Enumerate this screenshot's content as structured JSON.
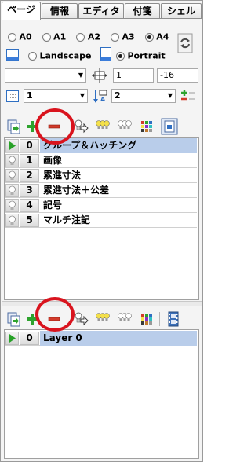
{
  "tabs": [
    {
      "label": "ページ",
      "active": true
    },
    {
      "label": "情報",
      "active": false
    },
    {
      "label": "エディタ",
      "active": false
    },
    {
      "label": "付箋",
      "active": false
    },
    {
      "label": "シェル",
      "active": false
    }
  ],
  "paper_sizes": [
    {
      "label": "A0",
      "selected": false
    },
    {
      "label": "A1",
      "selected": false
    },
    {
      "label": "A2",
      "selected": false
    },
    {
      "label": "A3",
      "selected": false
    },
    {
      "label": "A4",
      "selected": true
    }
  ],
  "orientation": {
    "landscape_label": "Landscape",
    "portrait_label": "Portrait",
    "selected": "Portrait"
  },
  "scale": {
    "combo_value": "",
    "field1": "1",
    "field2": "-16"
  },
  "layer_settings": {
    "combo1": "1",
    "combo2": "2"
  },
  "upper_layers": [
    {
      "num": "0",
      "name": "グループ＆ハッチング",
      "active": true
    },
    {
      "num": "1",
      "name": "画像",
      "active": false
    },
    {
      "num": "2",
      "name": "累進寸法",
      "active": false
    },
    {
      "num": "3",
      "name": "累進寸法＋公差",
      "active": false
    },
    {
      "num": "4",
      "name": "記号",
      "active": false
    },
    {
      "num": "5",
      "name": "マルチ注記",
      "active": false
    }
  ],
  "lower_layers": [
    {
      "num": "0",
      "name": "Layer 0",
      "active": true
    }
  ],
  "colors": {
    "selection": "#b9cdea",
    "highlight_circle": "#d9141e",
    "add_green": "#2ea32e",
    "remove_red": "#d23b2b"
  }
}
